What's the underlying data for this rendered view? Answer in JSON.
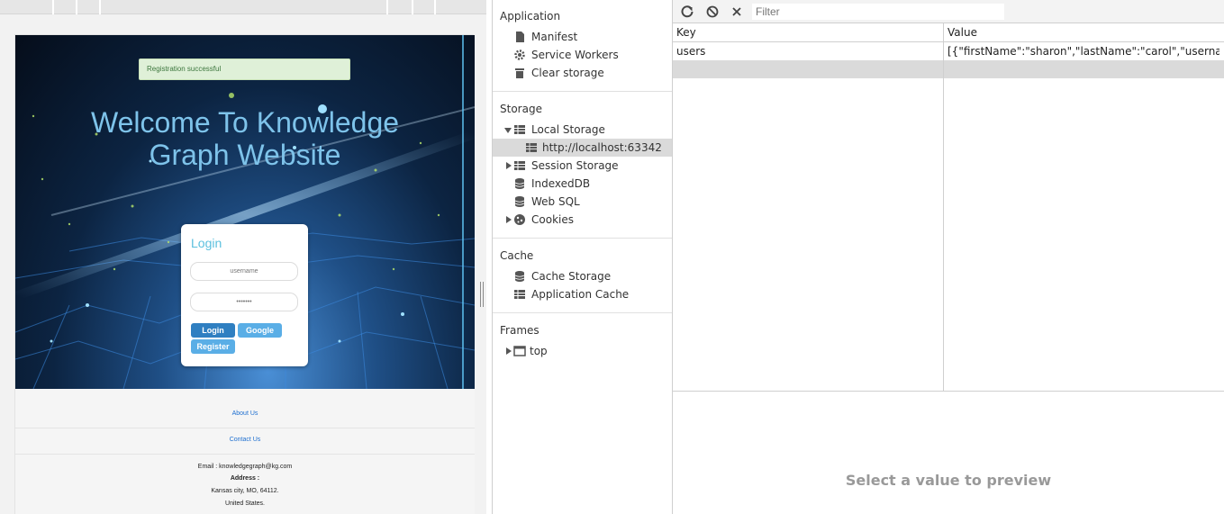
{
  "site": {
    "alert": "Registration successful",
    "hero_title": "Welcome To Knowledge Graph Website",
    "login": {
      "title": "Login",
      "username_placeholder": "username",
      "password_placeholder": "•••••••",
      "login_label": "Login",
      "google_label": "Google",
      "register_label": "Register"
    },
    "footer": {
      "about_link": "About Us",
      "contact_link": "Contact Us",
      "email": "Email : knowledgegraph@kg.com",
      "address_label": "Address :",
      "address_city": "Kansas city, MO, 64112.",
      "address_country": "United States."
    }
  },
  "sidebar": {
    "application": {
      "title": "Application",
      "items": [
        {
          "label": "Manifest",
          "icon": "document-icon"
        },
        {
          "label": "Service Workers",
          "icon": "gear-icon"
        },
        {
          "label": "Clear storage",
          "icon": "trash-icon"
        }
      ]
    },
    "storage": {
      "title": "Storage",
      "local_storage": "Local Storage",
      "local_storage_origin": "http://localhost:63342",
      "session_storage": "Session Storage",
      "indexeddb": "IndexedDB",
      "websql": "Web SQL",
      "cookies": "Cookies"
    },
    "cache": {
      "title": "Cache",
      "cache_storage": "Cache Storage",
      "application_cache": "Application Cache"
    },
    "frames": {
      "title": "Frames",
      "top": "top"
    }
  },
  "storage_table": {
    "filter_placeholder": "Filter",
    "columns": [
      "Key",
      "Value"
    ],
    "rows": [
      {
        "key": "users",
        "value": "[{\"firstName\":\"sharon\",\"lastName\":\"carol\",\"username\":…"
      }
    ],
    "preview_message": "Select a value to preview"
  }
}
